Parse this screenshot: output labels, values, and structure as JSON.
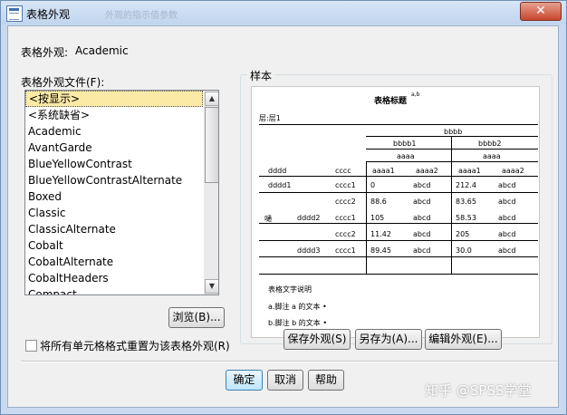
{
  "window": {
    "title": "表格外观",
    "ghost_text": "外观的指示值参数",
    "close_symbol": "✕"
  },
  "look": {
    "label": "表格外观:",
    "value": "Academic"
  },
  "files": {
    "label": "表格外观文件(F):",
    "items": [
      "<按显示>",
      "<系统缺省>",
      "Academic",
      "AvantGarde",
      "BlueYellowContrast",
      "BlueYellowContrastAlternate",
      "Boxed",
      "Classic",
      "ClassicAlternate",
      "Cobalt",
      "CobaltAlternate",
      "CobaltHeaders",
      "Compact"
    ]
  },
  "buttons": {
    "browse": "浏览(B)...",
    "save_look": "保存外观(S)",
    "save_as": "另存为(A)...",
    "edit_look": "编辑外观(E)...",
    "ok": "确定",
    "cancel": "取消",
    "help": "帮助"
  },
  "reset_checkbox": {
    "label": "将所有单元格格式重置为该表格外观(R)",
    "checked": false
  },
  "sample": {
    "group_label": "样本",
    "title": "表格标题",
    "title_sup": "a,b",
    "layer": "层:层1",
    "col_top": "bbbb",
    "col_b1": "bbbb1",
    "col_b2": "bbbb2",
    "col_a": "aaaa",
    "row_dim": "dddd",
    "row_c": "cccc",
    "col_a_cats": [
      "aaaa1",
      "aaaa2",
      "aaaa1",
      "aaaa2"
    ],
    "row_label_e": "嗵",
    "rows": [
      {
        "d": "dddd1",
        "d2": "",
        "c": "cccc1",
        "v": [
          "0",
          "abcd",
          "212.4",
          "abcd"
        ]
      },
      {
        "d": "",
        "d2": "",
        "c": "cccc2",
        "v": [
          "88.6",
          "abcd",
          "83.65",
          "abcd"
        ]
      },
      {
        "d": "",
        "d2": "dddd2",
        "c": "cccc1",
        "v": [
          "105",
          "abcd",
          "58.53",
          "abcd"
        ]
      },
      {
        "d": "",
        "d2": "",
        "c": "cccc2",
        "v": [
          "11.42",
          "abcd",
          "205",
          "abcd"
        ]
      },
      {
        "d": "",
        "d2": "dddd3",
        "c": "cccc1",
        "v": [
          "89.45",
          "abcd",
          "30.0",
          "abcd"
        ]
      }
    ],
    "caption": "表格文字说明",
    "footnotes": [
      "a.脚注 a 的文本 •",
      "b.脚注 b 的文本 •"
    ]
  },
  "watermark": "知乎 @SPSS学堂"
}
